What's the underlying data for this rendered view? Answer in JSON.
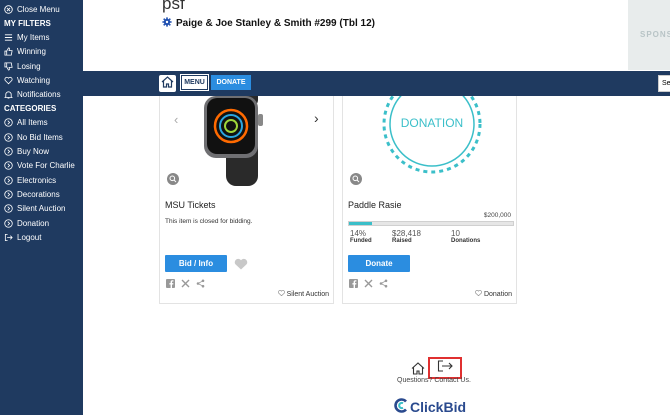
{
  "sidebar": {
    "close_label": "Close Menu",
    "filters_heading": "MY FILTERS",
    "filters": [
      {
        "label": "My Items",
        "icon": "list-icon"
      },
      {
        "label": "Winning",
        "icon": "thumbs-up-icon"
      },
      {
        "label": "Losing",
        "icon": "thumbs-down-icon"
      },
      {
        "label": "Watching",
        "icon": "heart-icon"
      },
      {
        "label": "Notifications",
        "icon": "bell-icon"
      }
    ],
    "categories_heading": "CATEGORIES",
    "categories": [
      {
        "label": "All Items"
      },
      {
        "label": "No Bid Items"
      },
      {
        "label": "Buy Now"
      },
      {
        "label": "Vote For Charlie"
      },
      {
        "label": "Electronics"
      },
      {
        "label": "Decorations"
      },
      {
        "label": "Silent Auction"
      },
      {
        "label": "Donation"
      }
    ],
    "logout_label": "Logout"
  },
  "header": {
    "title": "psf",
    "subtitle": "Paige & Joe Stanley & Smith #299 (Tbl 12)",
    "sponsor_text": "SPONS"
  },
  "navbar": {
    "menu_label": "MENU",
    "donate_label": "DONATE",
    "search_placeholder": "Se"
  },
  "cards": [
    {
      "title": "MSU Tickets",
      "note": "This item is closed for bidding.",
      "button_label": "Bid / Info",
      "category": "Silent Auction"
    },
    {
      "title": "Paddle Rasie",
      "image_text": "DONATION",
      "goal": "$200,000",
      "progress": 0.14,
      "funded_value": "14%",
      "funded_label": "Funded",
      "raised_value": "$28,418",
      "raised_label": "Raised",
      "donations_value": "10",
      "donations_label": "Donations",
      "button_label": "Donate",
      "category": "Donation"
    }
  ],
  "footer": {
    "links_text": "Questions? Contact Us.",
    "logo_text": "ClickBid"
  },
  "colors": {
    "navy": "#1f3a60",
    "accent_blue": "#2b8de0",
    "teal": "#3bbfc9",
    "highlight_red": "#e03030"
  }
}
